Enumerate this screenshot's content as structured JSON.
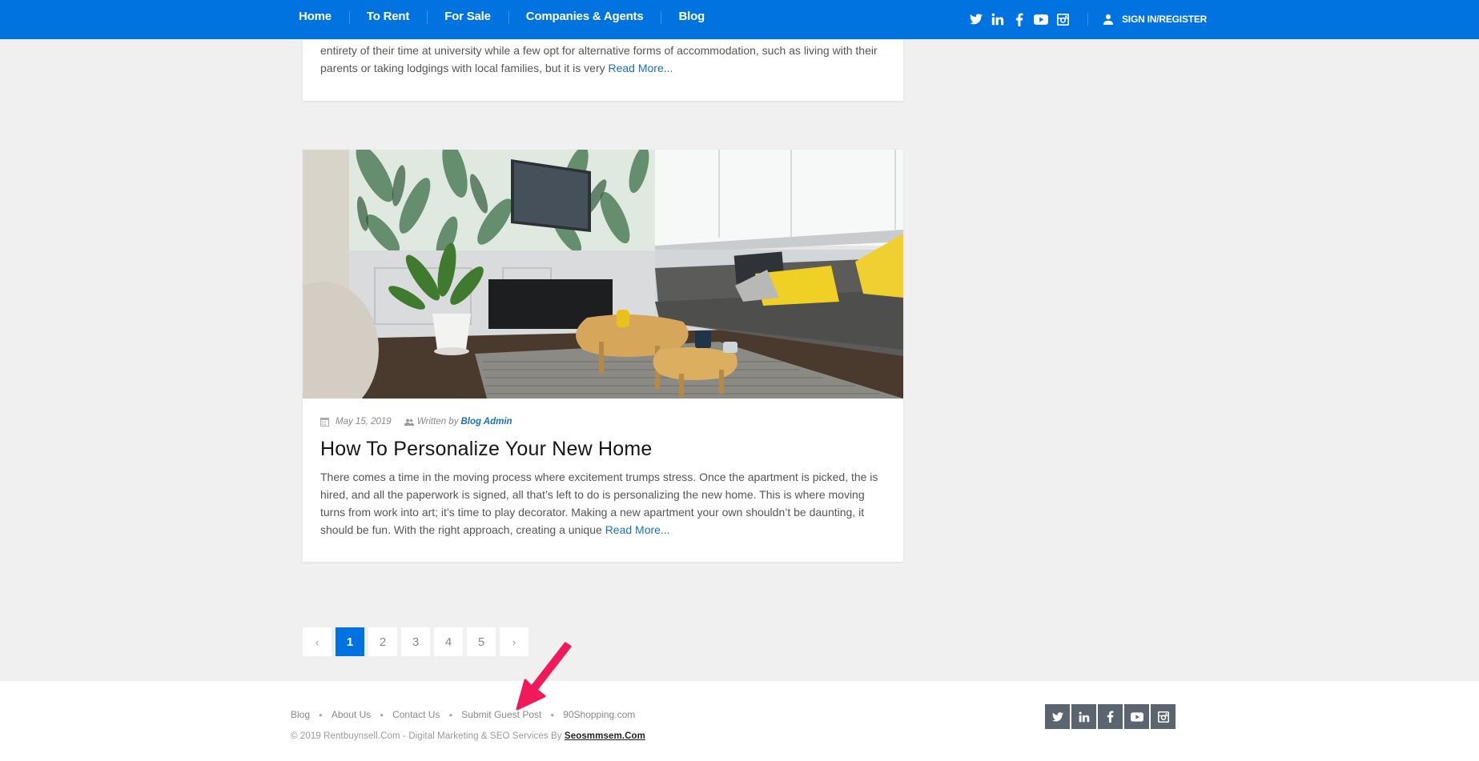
{
  "nav": {
    "items": [
      {
        "label": "Home"
      },
      {
        "label": "To Rent"
      },
      {
        "label": "For Sale"
      },
      {
        "label": "Companies & Agents"
      },
      {
        "label": "Blog"
      }
    ],
    "social_icons": [
      "twitter-icon",
      "linkedin-icon",
      "facebook-icon",
      "youtube-icon",
      "instagram-icon"
    ],
    "signin_label": "SIGN IN/REGISTER",
    "bar_color": "#0073e1"
  },
  "posts": [
    {
      "excerpt_line1": "entirety of their time at university while a few opt for alternative forms of accommodation, such as living with their",
      "excerpt_line2": "parents or taking lodgings with local families, but it is very",
      "read_more": "Read More..."
    },
    {
      "image_alt": "Living room with banana-leaf wallpaper, wall-mounted TV, grey sofa with yellow cushions and wooden coffee tables",
      "date": "May 15, 2019",
      "written_by": "Written by",
      "author": "Blog Admin",
      "title": "How To Personalize Your New Home",
      "excerpt": "There comes a time in the moving process where excitement trumps stress. Once the apartment is picked, the is hired, and all the paperwork is signed, all that’s left to do is personalizing the new home. This is where moving turns from work into art; it’s time to play decorator. Making a new apartment your own shouldn’t be daunting, it should be fun. With the right approach, creating a unique",
      "read_more": "Read More..."
    }
  ],
  "pagination": {
    "prev": "‹",
    "next": "›",
    "pages": [
      "1",
      "2",
      "3",
      "4",
      "5"
    ],
    "current": "1"
  },
  "footer": {
    "links": [
      "Blog",
      "About Us",
      "Contact Us",
      "Submit Guest Post",
      "90Shopping.com"
    ],
    "copyright": "© 2019 Rentbuynsell.Com - Digital Marketing & SEO Services By",
    "credit_link": "Seosmmsem.Com",
    "social_icons": [
      "twitter-icon",
      "linkedin-icon",
      "facebook-icon",
      "youtube-icon",
      "instagram-icon"
    ]
  },
  "annotation": {
    "type": "arrow",
    "color": "#f0195a",
    "points_to": "Submit Guest Post"
  }
}
